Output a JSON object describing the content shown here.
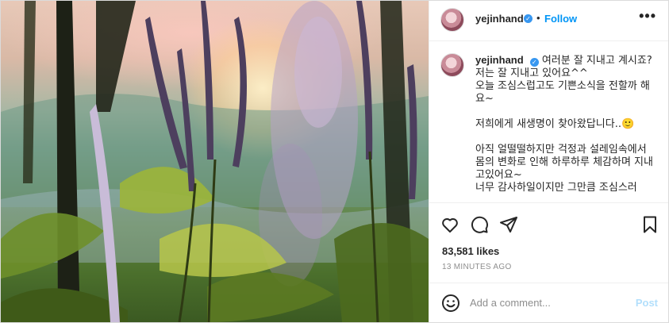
{
  "post": {
    "username": "yejinhand",
    "follow_label": "Follow",
    "more_label": "•••",
    "dot": "•"
  },
  "caption": {
    "username": "yejinhand",
    "text": "여러분 잘 지내고 계시죠?\n저는 잘 지내고 있어요^^\n오늘 조심스럽고도 기쁜소식을 전할까 해요~\n\n저희에게 새생명이 찾아왔답니다..🙂\n\n아직 얼떨떨하지만 걱정과 설레임속에서 몸의 변화로 인해 하루하루 체감하며 지내고있어요~\n너무 감사하일이지만 그만큼 조심스러"
  },
  "stats": {
    "likes": "83,581 likes",
    "time": "13 minutes ago"
  },
  "comment_box": {
    "placeholder": "Add a comment...",
    "post_label": "Post"
  },
  "icons": {
    "like": "heart-icon",
    "comment": "comment-icon",
    "share": "share-icon",
    "save": "bookmark-icon",
    "emoji": "smile-icon"
  },
  "colors": {
    "accent": "#0095f6",
    "verified": "#3897f0",
    "post_disabled": "#b2dffc"
  }
}
